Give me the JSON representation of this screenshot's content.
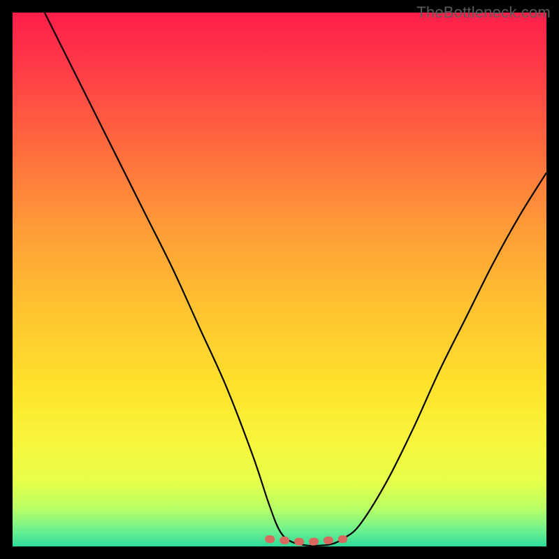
{
  "watermark": "TheBottleneck.com",
  "chart_data": {
    "type": "line",
    "title": "",
    "xlabel": "",
    "ylabel": "",
    "xlim": [
      0,
      100
    ],
    "ylim": [
      0,
      100
    ],
    "series": [
      {
        "name": "curve",
        "x": [
          6,
          10,
          15,
          20,
          25,
          30,
          35,
          40,
          45,
          48,
          50,
          52,
          55,
          58,
          60,
          62,
          65,
          70,
          75,
          80,
          85,
          90,
          95,
          100
        ],
        "y": [
          100,
          92,
          82,
          72,
          62,
          52,
          41,
          30,
          17,
          8,
          3,
          1,
          0.2,
          0.2,
          0.5,
          1.5,
          4,
          12,
          22,
          33,
          43,
          53,
          62,
          70
        ]
      },
      {
        "name": "highlight-band",
        "x": [
          48,
          62
        ],
        "y": [
          1.5,
          1.5
        ]
      }
    ],
    "gradient_stops": [
      {
        "offset": 0.0,
        "color": "#ff1e4a"
      },
      {
        "offset": 0.1,
        "color": "#ff3a47"
      },
      {
        "offset": 0.25,
        "color": "#ff6a3e"
      },
      {
        "offset": 0.4,
        "color": "#ff9a38"
      },
      {
        "offset": 0.55,
        "color": "#ffc230"
      },
      {
        "offset": 0.7,
        "color": "#ffe22c"
      },
      {
        "offset": 0.8,
        "color": "#f8f53a"
      },
      {
        "offset": 0.88,
        "color": "#e6ff4a"
      },
      {
        "offset": 0.93,
        "color": "#b6ff66"
      },
      {
        "offset": 0.97,
        "color": "#6cf08e"
      },
      {
        "offset": 1.0,
        "color": "#2fdc9a"
      }
    ],
    "highlight_color": "#d9685f",
    "curve_color": "#000000"
  }
}
